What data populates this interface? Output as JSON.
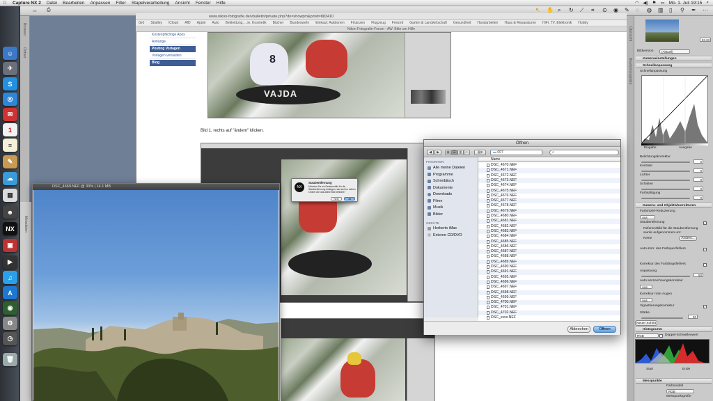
{
  "menubar": {
    "app_name": "Capture NX 2",
    "items": [
      "Datei",
      "Bearbeiten",
      "Anpassen",
      "Filter",
      "Stapelverarbeitung",
      "Ansicht",
      "Fenster",
      "Hilfe"
    ],
    "clock": "Mo. 1. Juli  19:15"
  },
  "browser": {
    "url": "www.nikon-fotografie.de/vbulletin/private.php?do=showpm&pmid=883410",
    "bookmarks": [
      "Stralley",
      "iCloud",
      "AfD",
      "Apple",
      "Auto",
      "Bekleidung, ...ie, Kosmetik",
      "Bücher",
      "Bundeswehr",
      "Einkauf, Auktionen",
      "Finanzen",
      "Flugzeug",
      "Freizeit",
      "Garten & Landwirtschaft",
      "Gesundheit",
      "Handarbeiten",
      "Haus & Reparaturen",
      "HiFi, TV, Elektronik",
      "Hobby"
    ],
    "tab_title": "Nikon Fotografie-Forum - AW: Bitte um Hilfe",
    "forum_nav": [
      "Kostenpflichtige Abos",
      "Anhänge",
      "Posting Vorlagen",
      "Vorlagen verwalten",
      "Blog"
    ],
    "caption": "Bild 1, rechts auf \"ändern\" klicken."
  },
  "image_window": {
    "title": "DSC_4669.NEF @ 33% | 14.1 MB"
  },
  "mini_dialog": {
    "title": "Staubentfernung",
    "text": "Möchten Sie ein Referenzbild für die Staubentfernung festlegen, das sich im selben Ordner wie das aktive Bild befindet?",
    "buttons": [
      "Nein",
      "Ja"
    ]
  },
  "open_dialog": {
    "title": "Öffnen",
    "folder": "007",
    "search_placeholder": "",
    "column_header": "Name",
    "favorites_heading": "FAVORITEN",
    "favorites": [
      "Alle meine Dateien",
      "Programme",
      "Schreibtisch",
      "Dokumente",
      "Downloads",
      "Filme",
      "Musik",
      "Bilder"
    ],
    "devices_heading": "GERÄTE",
    "devices": [
      "Herberts iMac",
      "Externe CD/DVD"
    ],
    "files": [
      "DSC_4670.NEF",
      "DSC_4671.NEF",
      "DSC_4672.NEF",
      "DSC_4673.NEF",
      "DSC_4674.NEF",
      "DSC_4675.NEF",
      "DSC_4676.NEF",
      "DSC_4677.NEF",
      "DSC_4678.NEF",
      "DSC_4679.NEF",
      "DSC_4680.NEF",
      "DSC_4681.NEF",
      "DSC_4682.NEF",
      "DSC_4683.NEF",
      "DSC_4684.NEF",
      "DSC_4685.NEF",
      "DSC_4686.NEF",
      "DSC_4687.NEF",
      "DSC_4688.NEF",
      "DSC_4689.NEF",
      "DSC_4690.NEF",
      "DSC_4691.NEF",
      "DSC_4695.NEF",
      "DSC_4696.NEF",
      "DSC_4697.NEF",
      "DSC_4698.NEF",
      "DSC_4699.NEF",
      "DSC_4700.NEF",
      "DSC_4701.NEF",
      "DSC_4702.NEF",
      "DSC_xxxx.NEF"
    ],
    "cancel_label": "Abbrechen",
    "open_label": "Öffnen"
  },
  "right_panel": {
    "bildversion_label": "Bildversion",
    "bildversion_value": "(Aktuell)",
    "sections": [
      "Kameraeinstellungen",
      "Schnellanpassung",
      "Schnellanpassung"
    ],
    "curve_labels": {
      "eingabe": "Eingabe",
      "ausgabe": "Ausgabe"
    },
    "sliders": [
      {
        "label": "Belichtungskorrektur",
        "value": "0"
      },
      {
        "label": "Kontrast",
        "value": "0"
      },
      {
        "label": "Lichter",
        "value": "0"
      },
      {
        "label": "Schatten",
        "value": "0"
      },
      {
        "label": "Farbsättigung",
        "value": "0"
      }
    ],
    "kamera_objektiv": "Kamera- und Objektivkorrekturen",
    "farbmoire": "Farbmoiré-Reduzierung",
    "farbmoire_value": "Aus",
    "staub": "Staubentfernung",
    "staub_ref": "Referenzbild für die Staubentfernung wurde aufgenommen um:",
    "staub_ref_value": "Keine",
    "aendern_label": "Ändern...",
    "autokorr": "Auto-Korr. des Farbquerfehlers",
    "farblaengs": "Korrektur des Farblängsfehlers",
    "anpassung_label": "Anpassung",
    "anpassung_value": "50",
    "auto_verz": "Auto-Verzeichnungskorrektur",
    "auto_verz_value": "Aus",
    "rote_augen": "Korrektur roter Augen",
    "rote_augen_value": "Aus",
    "vignette": "Vignettierungskorrektur",
    "staerke_label": "Stärke",
    "staerke_value": "50",
    "new_step_label": "Neuer Schritt",
    "histogram_label": "Histogramm",
    "histogram_mode": "RGB",
    "doppel_label": "Doppel-Schwellenwert",
    "start_label": "Start",
    "ende_label": "Ende",
    "messpunkte_label": "Messpunkte",
    "farbmodell_label": "Farbmodell",
    "farbmodell_value": "RGB",
    "messpunkt_label": "Messpunktgröße",
    "messpunkt_value": "3x3 Durchschnitt",
    "zoom_value": "33.33"
  },
  "colors": {
    "desktop": "#6f7f96",
    "forum_blue": "#3d5d94",
    "selection_blue": "#5c9ee6"
  }
}
